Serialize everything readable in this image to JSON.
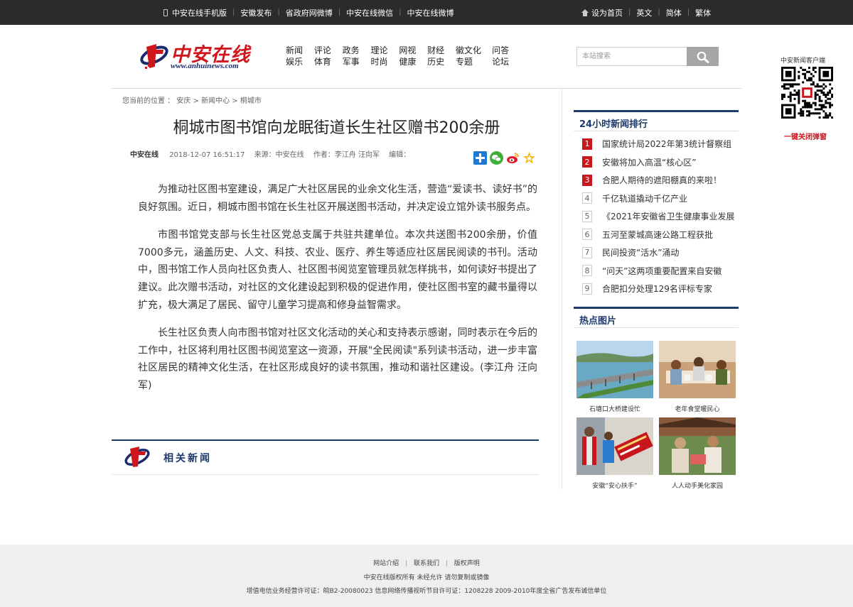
{
  "topbar": {
    "left_links": [
      "中安在线手机版",
      "安徽发布",
      "省政府网微博",
      "中安在线微信",
      "中安在线微博"
    ],
    "right_links": [
      "设为首页",
      "英文",
      "简体",
      "繁体"
    ]
  },
  "logo": {
    "name": "中安在线",
    "url": "www.anhuinews.com"
  },
  "mainnav": {
    "row1": [
      "新闻",
      "评论",
      "政务",
      "理论",
      "网视",
      "财经",
      "徽文化",
      "问答"
    ],
    "row2": [
      "娱乐",
      "体育",
      "军事",
      "时尚",
      "健康",
      "历史",
      "专题",
      "论坛"
    ]
  },
  "search": {
    "placeholder": "本站搜索"
  },
  "qr": {
    "label": "中安新闻客户端",
    "close": "一键关闭弹窗"
  },
  "breadcrumb": "您当前的位置 ： 安庆 > 新闻中心 > 桐城市",
  "article": {
    "title": "桐城市图书馆向龙眠街道长生社区赠书200余册",
    "source_brand": "中安在线",
    "datetime": "2018-12-07 16:51:17",
    "source": "来源：中安在线",
    "author": "作者：李江舟 汪向军",
    "editor": "编辑：",
    "paragraphs": [
      "为推动社区图书室建设，满足广大社区居民的业余文化生活，营造“爱读书、读好书”的良好氛围。近日，桐城市图书馆在长生社区开展送图书活动，并决定设立馆外读书服务点。",
      "市图书馆党支部与长生社区党总支属于共驻共建单位。本次共送图书200余册，价值7000多元，涵盖历史、人文、科技、农业、医疗、养生等适应社区居民阅读的书刊。活动中，图书馆工作人员向社区负责人、社区图书阅览室管理员就怎样挑书，如何读好书提出了建议。此次赠书活动，对社区的文化建设起到积极的促进作用，使社区图书室的藏书量得以扩充，极大满足了居民、留守儿童学习提高和修身益智需求。",
      "长生社区负责人向市图书馆对社区文化活动的关心和支持表示感谢，同时表示在今后的工作中，社区将利用社区图书阅览室这一资源，开展\"全民阅读\"系列读书活动，进一步丰富社区居民的精神文化生活，在社区形成良好的读书氛围，推动和谐社区建设。(李江舟 汪向军)"
    ]
  },
  "related": {
    "label": "相关新闻"
  },
  "sidebar": {
    "rank_title": "24小时新闻排行",
    "rank": [
      {
        "num": "1",
        "text": "国家统计局2022年第3统计督察组"
      },
      {
        "num": "2",
        "text": "安徽将加入高温“核心区”"
      },
      {
        "num": "3",
        "text": "合肥人期待的遮阳棚真的来啦！"
      },
      {
        "num": "4",
        "text": "千亿轨道撬动千亿产业"
      },
      {
        "num": "5",
        "text": "《2021年安徽省卫生健康事业发展"
      },
      {
        "num": "6",
        "text": "五河至蒙城高速公路工程获批"
      },
      {
        "num": "7",
        "text": "民间投资“活水”涌动"
      },
      {
        "num": "8",
        "text": "“问天”这两项重要配置来自安徽"
      },
      {
        "num": "9",
        "text": "合肥扣分处理129名评标专家"
      }
    ],
    "photo_title": "热点图片",
    "photos": [
      "石塘口大桥建设忙",
      "老年食堂暖民心",
      "安徽“安心扶手”",
      "人人动手美化家园"
    ]
  },
  "footer": {
    "links": [
      "网站介绍",
      "联系我们",
      "版权声明"
    ],
    "copyright": "中安在线版权所有 未经允许 请勿复制或镜像",
    "license": "增值电信业务经营许可证：皖B2-20080023 信息网络传播视听节目许可证：1208228  2009-2010年度全省广告发布诚信单位"
  },
  "colors": {
    "topbar": "#2b2b2b",
    "brand_red": "#c8161d",
    "brand_blue": "#1e3a6b"
  }
}
